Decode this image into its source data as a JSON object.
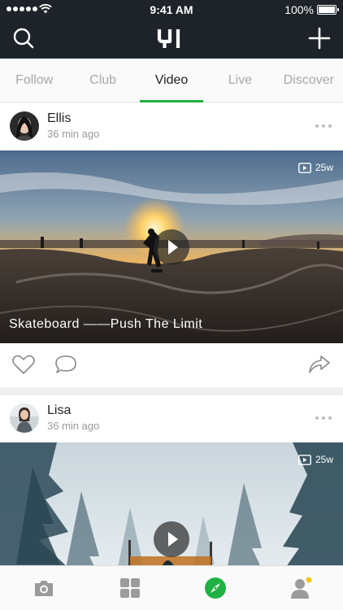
{
  "status_bar": {
    "time": "9:41 AM",
    "battery": "100%"
  },
  "nav": {
    "logo_text": "YI",
    "search_icon": "search-icon",
    "add_icon": "plus-icon"
  },
  "tabs": [
    {
      "label": "Follow",
      "active": false
    },
    {
      "label": "Club",
      "active": false
    },
    {
      "label": "Video",
      "active": true
    },
    {
      "label": "Live",
      "active": false
    },
    {
      "label": "Discover",
      "active": false
    }
  ],
  "accent_color": "#1fb144",
  "posts": [
    {
      "author": "Ellis",
      "time": "36 min ago",
      "views": "25w",
      "caption": "Skateboard ——Push The Limit"
    },
    {
      "author": "Lisa",
      "time": "36 min ago",
      "views": "25w",
      "caption": ""
    }
  ],
  "bottom_nav": [
    "camera-icon",
    "grid-icon",
    "compass-icon",
    "profile-icon"
  ]
}
